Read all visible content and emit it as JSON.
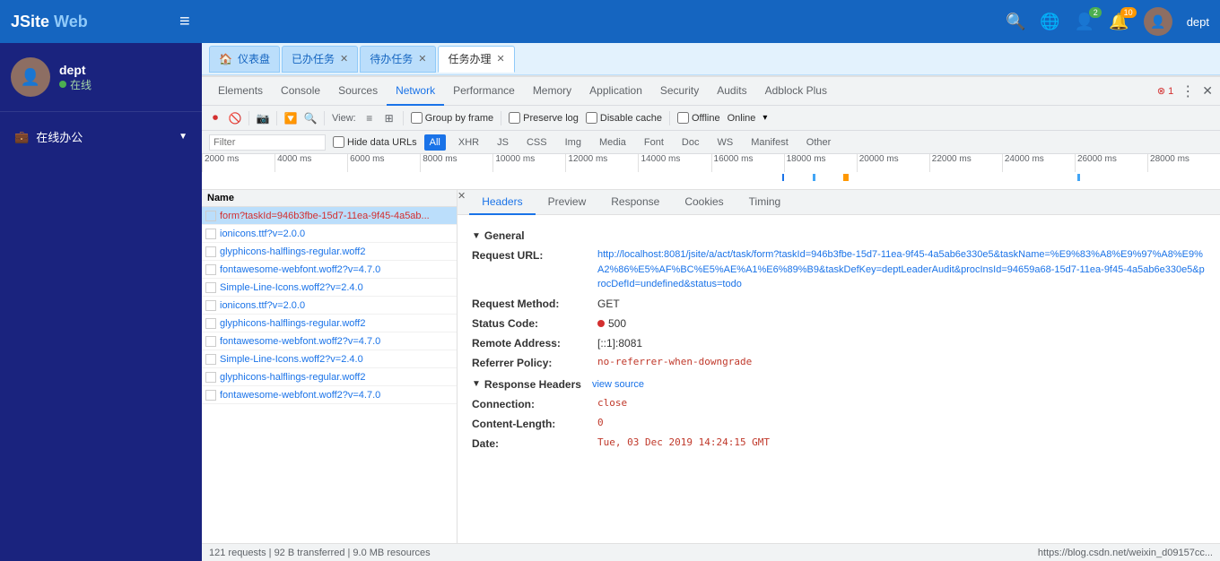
{
  "navbar": {
    "brand_prefix": "JSite",
    "brand_suffix": " Web",
    "hamburger": "≡",
    "icons": {
      "search": "🔍",
      "globe": "🌐",
      "person": "👤",
      "bell": "🔔",
      "avatar": "👤"
    },
    "badge_green": "2",
    "badge_orange": "10",
    "username": "dept"
  },
  "sidebar": {
    "username": "dept",
    "status": "在线",
    "menu_items": [
      {
        "label": "在线办公",
        "icon": "💼",
        "has_arrow": true
      }
    ]
  },
  "tabs": [
    {
      "label": "仪表盘",
      "icon": "🏠",
      "closable": false,
      "active": false
    },
    {
      "label": "已办任务",
      "closable": true,
      "active": false
    },
    {
      "label": "待办任务",
      "closable": true,
      "active": false
    },
    {
      "label": "任务办理",
      "closable": true,
      "active": false
    }
  ],
  "devtools": {
    "tabs": [
      "Elements",
      "Console",
      "Sources",
      "Network",
      "Performance",
      "Memory",
      "Application",
      "Security",
      "Audits",
      "Adblock Plus"
    ],
    "active_tab": "Network",
    "error_count": "1",
    "toolbar": {
      "preserve_log": "Preserve log",
      "disable_cache": "Disable cache",
      "offline": "Offline",
      "online": "Online",
      "view": "View:",
      "group_by_frame": "Group by frame",
      "hide_data_urls": "Hide data URLs"
    },
    "filter_types": [
      "All",
      "XHR",
      "JS",
      "CSS",
      "Img",
      "Media",
      "Font",
      "Doc",
      "WS",
      "Manifest",
      "Other"
    ],
    "active_filter": "All",
    "filter_placeholder": "Filter"
  },
  "timeline": {
    "marks": [
      "2000 ms",
      "4000 ms",
      "6000 ms",
      "8000 ms",
      "10000 ms",
      "12000 ms",
      "14000 ms",
      "16000 ms",
      "18000 ms",
      "20000 ms",
      "22000 ms",
      "24000 ms",
      "26000 ms",
      "28000 ms"
    ]
  },
  "request_list": {
    "header": "Name",
    "items": [
      {
        "name": "form?taskId=946b3fbe-15d7-11ea-9f45-4a5ab...",
        "error": true,
        "selected": true
      },
      {
        "name": "ionicons.ttf?v=2.0.0",
        "error": false,
        "selected": false
      },
      {
        "name": "glyphicons-halflings-regular.woff2",
        "error": false,
        "selected": false
      },
      {
        "name": "fontawesome-webfont.woff2?v=4.7.0",
        "error": false,
        "selected": false
      },
      {
        "name": "Simple-Line-Icons.woff2?v=2.4.0",
        "error": false,
        "selected": false
      },
      {
        "name": "ionicons.ttf?v=2.0.0",
        "error": false,
        "selected": false
      },
      {
        "name": "glyphicons-halflings-regular.woff2",
        "error": false,
        "selected": false
      },
      {
        "name": "fontawesome-webfont.woff2?v=4.7.0",
        "error": false,
        "selected": false
      },
      {
        "name": "Simple-Line-Icons.woff2?v=2.4.0",
        "error": false,
        "selected": false
      },
      {
        "name": "glyphicons-halflings-regular.woff2",
        "error": false,
        "selected": false
      },
      {
        "name": "fontawesome-webfont.woff2?v=4.7.0",
        "error": false,
        "selected": false
      }
    ],
    "summary": "121 requests | 92 B transferred | 9.0 MB resources"
  },
  "detail": {
    "tabs": [
      "Headers",
      "Preview",
      "Response",
      "Cookies",
      "Timing"
    ],
    "active_tab": "Headers",
    "general": {
      "title": "General",
      "request_url_label": "Request URL:",
      "request_url_value": "http://localhost:8081/jsite/a/act/task/form?taskId=946b3fbe-15d7-11ea-9f45-4a5ab6e330e5&taskName=%E9%83%A8%E9%97%A8%E9%A2%86%E5%AF%BC%E5%AE%A1%E6%89%B9&taskDefKey=deptLeaderAudit&procInsId=94659a68-15d7-11ea-9f45-4a5ab6e330e5&procDefId=undefined&status=todo",
      "request_method_label": "Request Method:",
      "request_method_value": "GET",
      "status_code_label": "Status Code:",
      "status_code_value": "500",
      "remote_address_label": "Remote Address:",
      "remote_address_value": "[::1]:8081",
      "referrer_policy_label": "Referrer Policy:",
      "referrer_policy_value": "no-referrer-when-downgrade"
    },
    "response_headers": {
      "title": "Response Headers",
      "view_source": "view source",
      "connection_label": "Connection:",
      "connection_value": "close",
      "content_length_label": "Content-Length:",
      "content_length_value": "0",
      "date_label": "Date:",
      "date_value": "Tue, 03 Dec 2019 14:24:15 GMT"
    }
  },
  "statusbar": {
    "text": "https://blog.csdn.net/weixin_d09157cc..."
  }
}
